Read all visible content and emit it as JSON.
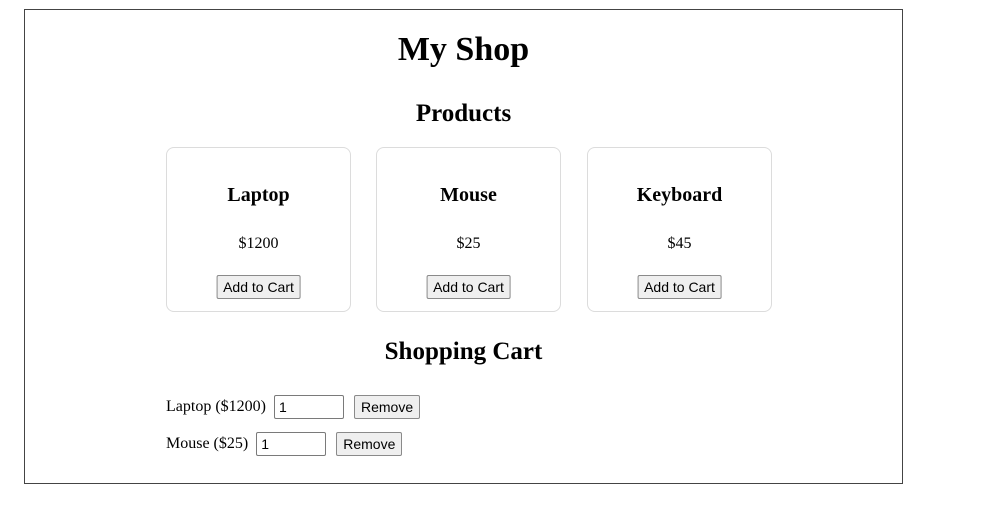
{
  "shop": {
    "title": "My Shop"
  },
  "products_section": {
    "heading": "Products",
    "items": [
      {
        "name": "Laptop",
        "price": "$1200",
        "button_label": "Add to Cart"
      },
      {
        "name": "Mouse",
        "price": "$25",
        "button_label": "Add to Cart"
      },
      {
        "name": "Keyboard",
        "price": "$45",
        "button_label": "Add to Cart"
      }
    ]
  },
  "cart_section": {
    "heading": "Shopping Cart",
    "items": [
      {
        "label": "Laptop ($1200)",
        "quantity": "1",
        "remove_label": "Remove"
      },
      {
        "label": "Mouse ($25)",
        "quantity": "1",
        "remove_label": "Remove"
      }
    ]
  }
}
